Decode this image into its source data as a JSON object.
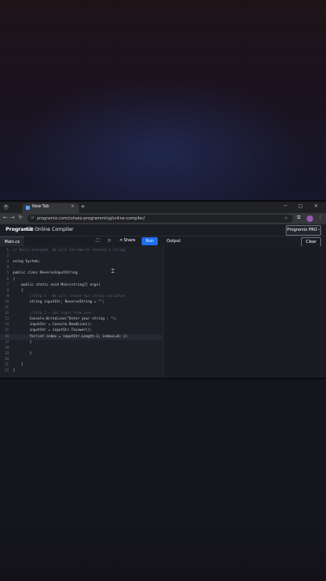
{
  "browser": {
    "tab_title": "New Tab",
    "tab_close": "×",
    "new_tab": "+",
    "url": "programiz.com/csharp-programming/online-compiler/",
    "window_controls": "─ ▢ ✕"
  },
  "site": {
    "logo": "Programiz",
    "title": "C# Online Compiler",
    "pro_button": "Programiz PRO ›"
  },
  "toolbar": {
    "file_tab": "Main.cs",
    "share_label": "Share",
    "run_label": "Run",
    "output_label": "Output",
    "clear_label": "Clear"
  },
  "editor": {
    "lines": [
      {
        "n": "1",
        "text": "// Hello everyone, We will see how to reverse a string",
        "comment": true
      },
      {
        "n": "2",
        "text": ""
      },
      {
        "n": "3",
        "text": "using System;"
      },
      {
        "n": "4",
        "text": ""
      },
      {
        "n": "5",
        "text": "public class ReverseInputString"
      },
      {
        "n": "6",
        "text": "{"
      },
      {
        "n": "7",
        "text": "    public static void Main(string[] args)"
      },
      {
        "n": "8",
        "text": "    {"
      },
      {
        "n": "9",
        "text": "        //Step 1 - We will create two string variables",
        "comment": true
      },
      {
        "n": "10",
        "text": "        string inputStr, ReverseString = \"\";"
      },
      {
        "n": "11",
        "text": ""
      },
      {
        "n": "12",
        "text": "        //Step 2 - Get input from user",
        "comment": true
      },
      {
        "n": "13",
        "text": "        Console.WriteLine(\"Enter your string : \");"
      },
      {
        "n": "14",
        "text": "        inputStr = Console.ReadLine();"
      },
      {
        "n": "15",
        "text": "        inputStr = inputStr.ToLower();"
      },
      {
        "n": "16",
        "text": "        for(int index = inputStr.Length-1; index>=0; i)",
        "active": true
      },
      {
        "n": "17",
        "text": "        {"
      },
      {
        "n": "18",
        "text": ""
      },
      {
        "n": "19",
        "text": "        }"
      },
      {
        "n": "20",
        "text": ""
      },
      {
        "n": "21",
        "text": "    }"
      },
      {
        "n": "22",
        "text": "}"
      }
    ]
  }
}
